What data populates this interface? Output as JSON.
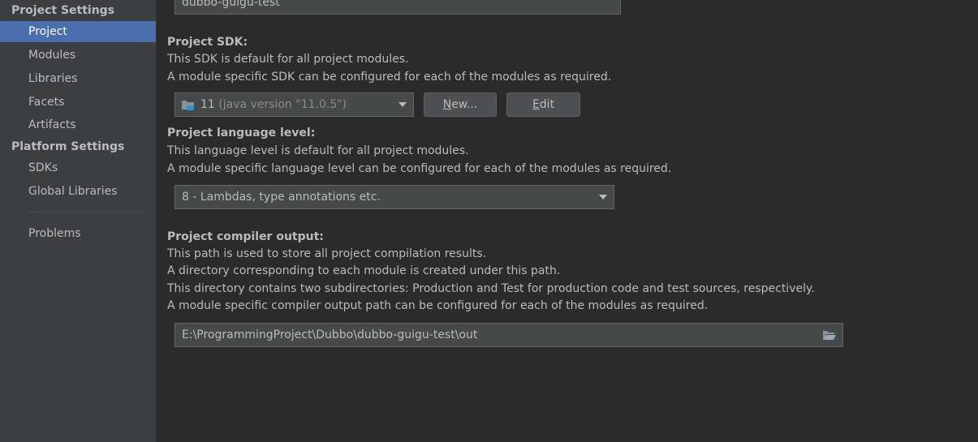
{
  "sidebar": {
    "project_settings_header": "Project Settings",
    "platform_settings_header": "Platform Settings",
    "items": [
      {
        "label": "Project"
      },
      {
        "label": "Modules"
      },
      {
        "label": "Libraries"
      },
      {
        "label": "Facets"
      },
      {
        "label": "Artifacts"
      }
    ],
    "platform_items": [
      {
        "label": "SDKs"
      },
      {
        "label": "Global Libraries"
      }
    ],
    "problems_label": "Problems",
    "selected": "Project"
  },
  "project_name": {
    "value": "dubbo-guigu-test"
  },
  "sdk": {
    "heading": "Project SDK:",
    "desc1": "This SDK is default for all project modules.",
    "desc2": "A module specific SDK can be configured for each of the modules as required.",
    "selected_version": "11",
    "selected_detail": "(java version \"11.0.5\")",
    "icon": "folder-icon",
    "new_button_mnemonic": "N",
    "new_button_rest": "ew...",
    "edit_button_mnemonic": "E",
    "edit_button_rest": "dit"
  },
  "language_level": {
    "heading": "Project language level:",
    "desc1": "This language level is default for all project modules.",
    "desc2": "A module specific language level can be configured for each of the modules as required.",
    "selected": "8 - Lambdas, type annotations etc."
  },
  "compiler_output": {
    "heading": "Project compiler output:",
    "desc1": "This path is used to store all project compilation results.",
    "desc2": "A directory corresponding to each module is created under this path.",
    "desc3": "This directory contains two subdirectories: Production and Test for production code and test sources, respectively.",
    "desc4": "A module specific compiler output path can be configured for each of the modules as required.",
    "path": "E:\\ProgrammingProject\\Dubbo\\dubbo-guigu-test\\out",
    "browse_icon": "folder-open-icon"
  },
  "colors": {
    "background": "#2b2b2b",
    "sidebar": "#3c3f41",
    "selection": "#4b6eaf",
    "field": "#45494a",
    "text": "#bbbbbb"
  }
}
